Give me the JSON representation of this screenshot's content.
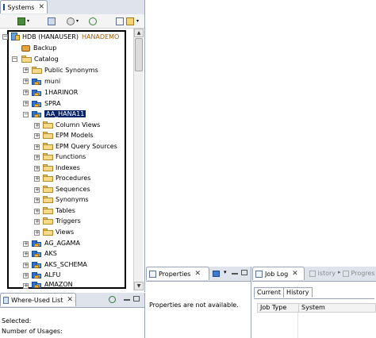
{
  "systems_view": {
    "tab_label": "Systems",
    "close_glyph": "✕",
    "tree": {
      "system": "HDB (HANAUSER)",
      "system_suffix": "HANADEMO",
      "backup": "Backup",
      "catalog": "Catalog",
      "schemas_top": [
        "Public Synonyms",
        "muni",
        "1HARINOR",
        "SPRA"
      ],
      "selected_schema": "AA_HANA11",
      "schema_children": [
        "Column Views",
        "EPM Models",
        "EPM Query Sources",
        "Functions",
        "Indexes",
        "Procedures",
        "Sequences",
        "Synonyms",
        "Tables",
        "Triggers",
        "Views"
      ],
      "schemas_bottom": [
        "AG_AGAMA",
        "AKS",
        "AKS_SCHEMA",
        "ALFU",
        "AMAZON"
      ]
    }
  },
  "where_used": {
    "tab_label": "Where-Used List",
    "close_glyph": "✕",
    "selected_label": "Selected:",
    "usages_label": "Number of Usages:"
  },
  "properties_view": {
    "tab_label": "Properties",
    "close_glyph": "✕",
    "message": "Properties are not available."
  },
  "job_log": {
    "tab_label": "Job Log",
    "close_glyph": "✕",
    "other_tabs": [
      "istory",
      "Progres"
    ],
    "subtabs": [
      "Current",
      "History"
    ],
    "columns": [
      "Job Type",
      "System"
    ]
  },
  "colors": {
    "selection": "#0a246a",
    "tab_strip": "#dfe3ec",
    "highlight_box": "#000000",
    "system_suffix": "#a05a00"
  }
}
